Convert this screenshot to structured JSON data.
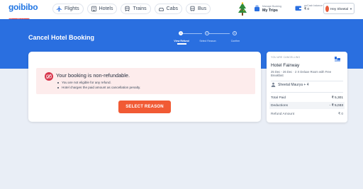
{
  "brand": {
    "logo_text": "goibibo",
    "logo_sub": "Merry Christmas"
  },
  "nav": {
    "items": [
      {
        "label": "Flights",
        "icon": "flight-icon"
      },
      {
        "label": "Hotels",
        "icon": "hotel-icon"
      },
      {
        "label": "Trains",
        "icon": "train-icon"
      },
      {
        "label": "Cabs",
        "icon": "cab-icon"
      },
      {
        "label": "Bus",
        "icon": "bus-icon"
      }
    ]
  },
  "header": {
    "trips_small": "Manage Booking",
    "trips_label": "My Trips",
    "wallet_small": "goCash balance",
    "wallet_amount": "₹ 0",
    "user_label": "Hey Sheetal"
  },
  "page": {
    "title": "Cancel Hotel Booking"
  },
  "stepper": {
    "steps": [
      {
        "num": "1",
        "label": "View Refund"
      },
      {
        "num": "2",
        "label": "Select Reason"
      },
      {
        "num": "3",
        "label": "Confirm"
      }
    ]
  },
  "alert": {
    "title": "Your booking is non-refundable.",
    "points": [
      "You are not eligible for any refund.",
      "Hotel charges the paid amount as cancellation penalty."
    ]
  },
  "actions": {
    "select_reason": "SELECT REASON"
  },
  "summary": {
    "caption": "YOU ARE CANCELLING",
    "hotel_name": "Hotel Fairway",
    "details": "25 Dec - 26 Dec · 2 X Deluxe Room with Free Breakfast",
    "guests": "Sheetal Maurya + 4",
    "rows": [
      {
        "label": "Total Paid",
        "value": "₹ 5,301"
      },
      {
        "label": "Deductions",
        "value": "- ₹ 5,033"
      },
      {
        "label": "Refund Amount",
        "value": "₹ 0"
      }
    ]
  },
  "colors": {
    "brand_blue": "#2a6fe0",
    "cta_orange": "#f15a34",
    "alert_red": "#d7334a",
    "alert_bg": "#fdecec"
  }
}
